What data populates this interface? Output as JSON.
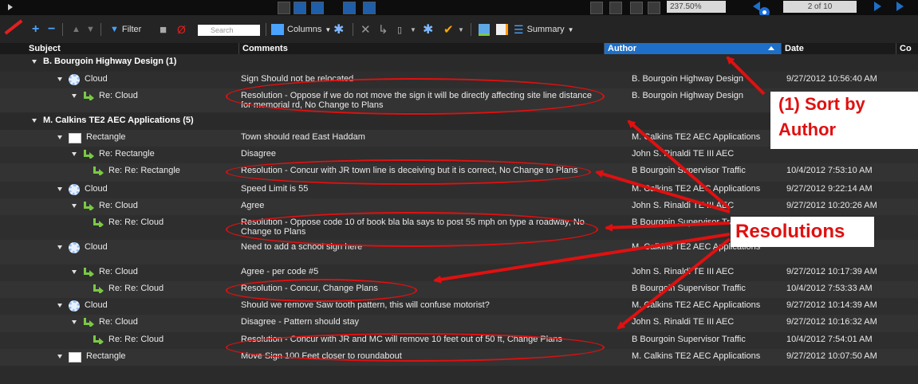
{
  "topbar": {
    "zoom_value": "237.50%",
    "page_value": "2 of 10"
  },
  "toolbar": {
    "filter_label": "Filter",
    "search_placeholder": "Search",
    "columns_label": "Columns",
    "summary_label": "Summary"
  },
  "table": {
    "headers": {
      "subject": "Subject",
      "comments": "Comments",
      "author": "Author",
      "date": "Date",
      "extra": "Co"
    },
    "rows": [
      {
        "level": 0,
        "type": "group",
        "subject": "B. Bourgoin Highway Design (1)",
        "comment": "",
        "author": "",
        "date": ""
      },
      {
        "level": 1,
        "type": "cloud",
        "subject": "Cloud",
        "comment": "Sign Should not be relocated",
        "author": "B. Bourgoin Highway Design",
        "date": "9/27/2012 10:56:40 AM"
      },
      {
        "level": 2,
        "type": "reply",
        "subject": "Re: Cloud",
        "comment": "Resolution - Oppose if we do not move the sign it will be directly affecting site line distance for memorial rd, No Change to Plans",
        "author": "B. Bourgoin Highway Design",
        "date": ""
      },
      {
        "level": 0,
        "type": "group",
        "subject": "M. Calkins TE2 AEC Applications (5)",
        "comment": "",
        "author": "",
        "date": ""
      },
      {
        "level": 1,
        "type": "rect",
        "subject": "Rectangle",
        "comment": "Town should read East Haddam",
        "author": "M. Calkins TE2 AEC Applications",
        "date": ""
      },
      {
        "level": 2,
        "type": "reply",
        "subject": "Re: Rectangle",
        "comment": "Disagree",
        "author": "John S. Rinaldi TE III AEC",
        "date": ""
      },
      {
        "level": 3,
        "type": "reply",
        "subject": "Re: Re: Rectangle",
        "comment": "Resolution - Concur with JR town line is deceiving but it is correct, No Change to Plans",
        "author": "B Bourgoin Supervisor Traffic",
        "date": "10/4/2012 7:53:10 AM"
      },
      {
        "level": 1,
        "type": "cloud",
        "subject": "Cloud",
        "comment": "Speed Limit is 55",
        "author": "M. Calkins TE2 AEC Applications",
        "date": "9/27/2012 9:22:14 AM"
      },
      {
        "level": 2,
        "type": "reply",
        "subject": "Re: Cloud",
        "comment": "Agree",
        "author": "John S. Rinaldi TE III AEC",
        "date": "9/27/2012 10:20:26 AM"
      },
      {
        "level": 3,
        "type": "reply",
        "subject": "Re: Re: Cloud",
        "comment": "Resolution - Oppose code 10 of book bla bla says to post 55 mph on type a roadway, No Change to Plans",
        "author": "B Bourgoin Supervisor Traffic",
        "date": ""
      },
      {
        "level": 1,
        "type": "cloud",
        "subject": "Cloud",
        "comment": "Need to add a school sign here",
        "author": "M. Calkins TE2 AEC Applications",
        "date": ""
      },
      {
        "level": 2,
        "type": "reply",
        "subject": "Re: Cloud",
        "comment": "Agree - per code #5",
        "author": "John S. Rinaldi TE III AEC",
        "date": "9/27/2012 10:17:39 AM"
      },
      {
        "level": 3,
        "type": "reply",
        "subject": "Re: Re: Cloud",
        "comment": "Resolution - Concur, Change Plans",
        "author": "B Bourgoin Supervisor Traffic",
        "date": "10/4/2012 7:53:33 AM"
      },
      {
        "level": 1,
        "type": "cloud",
        "subject": "Cloud",
        "comment": "Should we remove Saw tooth pattern, this will confuse motorist?",
        "author": "M. Calkins TE2 AEC Applications",
        "date": "9/27/2012 10:14:39 AM"
      },
      {
        "level": 2,
        "type": "reply",
        "subject": "Re: Cloud",
        "comment": "Disagree - Pattern should stay",
        "author": "John S. Rinaldi TE III AEC",
        "date": "9/27/2012 10:16:32 AM"
      },
      {
        "level": 3,
        "type": "reply",
        "subject": "Re: Re: Cloud",
        "comment": "Resolution - Concur with JR and MC will remove 10 feet out of 50 ft, Change Plans",
        "author": "B Bourgoin Supervisor Traffic",
        "date": "10/4/2012 7:54:01 AM"
      },
      {
        "level": 1,
        "type": "rect",
        "subject": "Rectangle",
        "comment": "Move Sign 100 Feet closer to roundabout",
        "author": "M. Calkins TE2 AEC Applications",
        "date": "9/27/2012 10:07:50 AM"
      }
    ]
  },
  "annotations": {
    "sort_by_author_line1": "(1) Sort by",
    "sort_by_author_line2": "Author",
    "resolutions": "Resolutions",
    "color": "#e01010"
  },
  "colors": {
    "background": "#2b2b2b",
    "header_active": "#1e6fc8",
    "reply_arrow": "#7ac943"
  }
}
